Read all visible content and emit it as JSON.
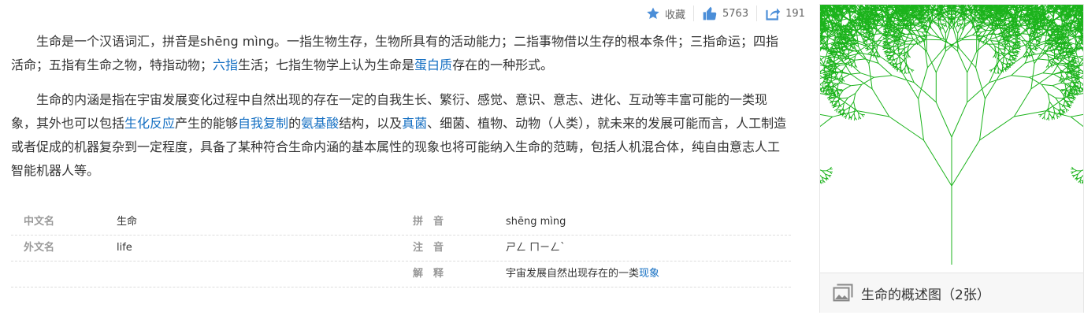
{
  "toolbar": {
    "collect_label": "收藏",
    "like_count": "5763",
    "share_count": "191",
    "colors": {
      "accent": "#4b8ed8",
      "text": "#666666"
    }
  },
  "content": {
    "p1": {
      "t1": "生命是一个汉语词汇，拼音是shēng mìng。一指生物生存，生物所具有的活动能力；二指事物借以生存的根本条件；三指命运；四指活命；五指有生命之物，特指动物；",
      "link1": "六指",
      "t2": "生活；七指生物学上认为生命是",
      "link2": "蛋白质",
      "t3": "存在的一种形式。"
    },
    "p2": {
      "t1": "生命的内涵是指在宇宙发展变化过程中自然出现的存在一定的自我生长、繁衍、感觉、意识、意志、进化、互动等丰富可能的一类现象，其外也可以包括",
      "link1": "生化反应",
      "t2": "产生的能够",
      "link2": "自我复制",
      "t3": "的",
      "link3": "氨基酸",
      "t4": "结构，以及",
      "link4": "真菌",
      "t5": "、细菌、植物、动物（人类），就未来的发展可能而言，人工制造或者促成的机器复杂到一定程度，具备了某种符合生命内涵的基本属性的现象也将可能纳入生命的范畴，包括人机混合体，纯自由意志人工智能机器人等。"
    },
    "link_color": "#136ec2"
  },
  "basic_info": {
    "rows": [
      {
        "left_key": "中文名",
        "left_value": "生命",
        "right_key": "拼　音",
        "right_value": "shēng mìng"
      },
      {
        "left_key": "外文名",
        "left_value": "life",
        "right_key": "注　音",
        "right_value": "ㄕㄥ ㄇㄧㄥˋ"
      },
      {
        "left_key": "",
        "left_value": "",
        "right_key": "解　释",
        "right_value_text": "宇宙发展自然出现存在的一类",
        "right_value_link": "现象"
      }
    ]
  },
  "album": {
    "caption": "生命的概述图（2张）",
    "image_desc_icon": "fractal-tree-image",
    "tree_color": "#1bb31b"
  }
}
